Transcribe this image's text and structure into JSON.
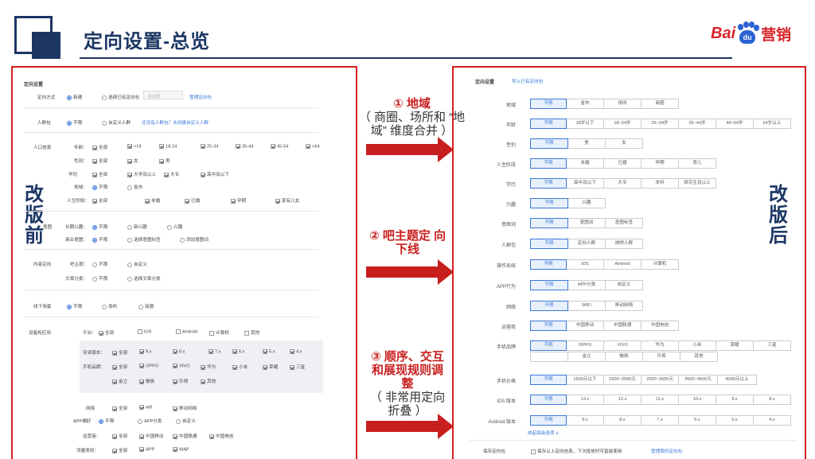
{
  "slide": {
    "title": "定向设置-总览"
  },
  "logo": {
    "bai": "Bai",
    "du": "du",
    "cn": "营销"
  },
  "labels": {
    "before": [
      "改",
      "版",
      "前"
    ],
    "after": [
      "改",
      "版",
      "后"
    ]
  },
  "notes": [
    {
      "head": "① 地域",
      "sub": "（ 商圈、场所和 “地域” 维度合并 ）"
    },
    {
      "head": "② 吧主题定 向下线",
      "sub": ""
    },
    {
      "head": "③ 顺序、交互 和展现规则调 整",
      "sub": "（ 非常用定向 折叠 ）"
    }
  ],
  "left": {
    "heading": "定向设置",
    "method": {
      "label": "定向方式",
      "new": "新建",
      "choose": "选择已有定向包",
      "select_placeholder": "请选择",
      "link": "管理定向包"
    },
    "crowd": {
      "label": "人群包",
      "none": "不限",
      "custom": "自定义人群",
      "hint": "还没有人群包？去创建自定义人群"
    },
    "group_info": "人口信息",
    "age": {
      "label": "年龄：",
      "opts": [
        "全部",
        "<18",
        "18-24",
        "25-34",
        "35-44",
        "45-54",
        ">54"
      ]
    },
    "gender": {
      "label": "性别：",
      "opts": [
        "全部",
        "女",
        "男"
      ]
    },
    "edu": {
      "label": "学历",
      "opts": [
        "全部",
        "大学及以上",
        "大专",
        "高中及以下"
      ]
    },
    "region": {
      "label": "地域：",
      "opts": [
        "不限",
        "省市"
      ]
    },
    "stage": {
      "label": "人生阶段：",
      "opts": [
        "全部",
        "未婚",
        "已婚",
        "孕期",
        "家有儿女"
      ]
    },
    "interest_group": "意图",
    "interest": {
      "label": "长期兴趣：",
      "opts": [
        "不限",
        "新兴趣",
        "兴趣"
      ]
    },
    "biz": {
      "label": "商业意图：",
      "opts": [
        "不限",
        "选择意图标签",
        "添加意图词"
      ]
    },
    "content_group": "内容定向",
    "bar": {
      "label": "吧主题：",
      "opts": [
        "不限",
        "自定义"
      ]
    },
    "article": {
      "label": "文章分类：",
      "opts": [
        "不限",
        "选择文章分类"
      ]
    },
    "offline": {
      "label": "线下场景",
      "opts": [
        "不限",
        "场所",
        "商圈"
      ]
    },
    "device_group": "设备和应用",
    "platform": {
      "label": "平台：",
      "opts": [
        "全部",
        "iOS",
        "Android",
        "计算机",
        "其他"
      ]
    },
    "android_ver": {
      "label": "安卓版本：",
      "opts": [
        "全部",
        "9.x",
        "8.x",
        "7.x",
        "6.x",
        "5.x",
        "4.x"
      ]
    },
    "brand": {
      "label": "手机品牌：",
      "opts": [
        "全部",
        "OPPO",
        "VIVO",
        "华为",
        "小米",
        "荣耀",
        "三星",
        "金立",
        "魅族",
        "乐视",
        "其他"
      ]
    },
    "network": {
      "label": "网络",
      "opts": [
        "全部",
        "wifi",
        "移动网络"
      ]
    },
    "app": {
      "label": "APP偏好",
      "opts": [
        "不限",
        "APP分类",
        "自定义"
      ]
    },
    "carrier": {
      "label": "运营商：",
      "opts": [
        "全部",
        "中国移动",
        "中国联通",
        "中国电信"
      ]
    },
    "flow": {
      "label": "流量类别：",
      "opts": [
        "全部",
        "APP",
        "WAP"
      ]
    }
  },
  "right": {
    "heading": "定向设置",
    "import_link": "导入已有定向包",
    "rows": [
      {
        "label": "地域",
        "opts": [
          "不限",
          "省市",
          "场所",
          "商圈"
        ]
      },
      {
        "label": "年龄",
        "opts": [
          "不限",
          "18岁以下",
          "18~24岁",
          "25~34岁",
          "35~44岁",
          "44~54岁",
          "54岁以上"
        ]
      },
      {
        "label": "性别",
        "opts": [
          "不限",
          "男",
          "女"
        ]
      },
      {
        "label": "人生阶段",
        "opts": [
          "不限",
          "未婚",
          "已婚",
          "孕期",
          "育儿"
        ]
      },
      {
        "label": "学历",
        "opts": [
          "不限",
          "高中及以下",
          "大专",
          "本科",
          "研究生及以上"
        ]
      },
      {
        "label": "兴趣",
        "opts": [
          "不限",
          "兴趣"
        ]
      },
      {
        "label": "意图词",
        "opts": [
          "不限",
          "意图词",
          "意图标签"
        ]
      },
      {
        "label": "人群包",
        "opts": [
          "不限",
          "定向人群",
          "排除人群"
        ]
      },
      {
        "label": "操作系统",
        "opts": [
          "不限",
          "iOS",
          "Android",
          "计算机"
        ]
      },
      {
        "label": "APP行为",
        "opts": [
          "不限",
          "APP分类",
          "自定义"
        ]
      },
      {
        "label": "网络",
        "opts": [
          "不限",
          "WIFI",
          "移动网络"
        ]
      },
      {
        "label": "运营商",
        "opts": [
          "不限",
          "中国移动",
          "中国联通",
          "中国电信"
        ]
      },
      {
        "label": "手机品牌",
        "opts": [
          "不限",
          "OPPO",
          "VIVO",
          "华为",
          "小米",
          "荣耀",
          "三星"
        ],
        "opts2": [
          "金立",
          "魅族",
          "乐视",
          "其他"
        ]
      },
      {
        "label": "手机价格",
        "opts": [
          "不限",
          "1500元以下",
          "1500~2500元",
          "2500~3500元",
          "3500~4500元",
          "4000元以上"
        ]
      },
      {
        "label": "iOS 版本",
        "opts": [
          "不限",
          "13.x",
          "12.x",
          "11.x",
          "10.x",
          "9.x",
          "8.x"
        ]
      },
      {
        "label": "Andriod 版本",
        "opts": [
          "不限",
          "9.x",
          "8.x",
          "7.x",
          "6.x",
          "5.x",
          "4.x"
        ]
      }
    ],
    "collapse": "收起高级选项 ∧",
    "save": {
      "label": "保存定向包",
      "text": "保存以上定向信息，下次投放时可直接使用",
      "link": "管理我的定向包"
    }
  }
}
